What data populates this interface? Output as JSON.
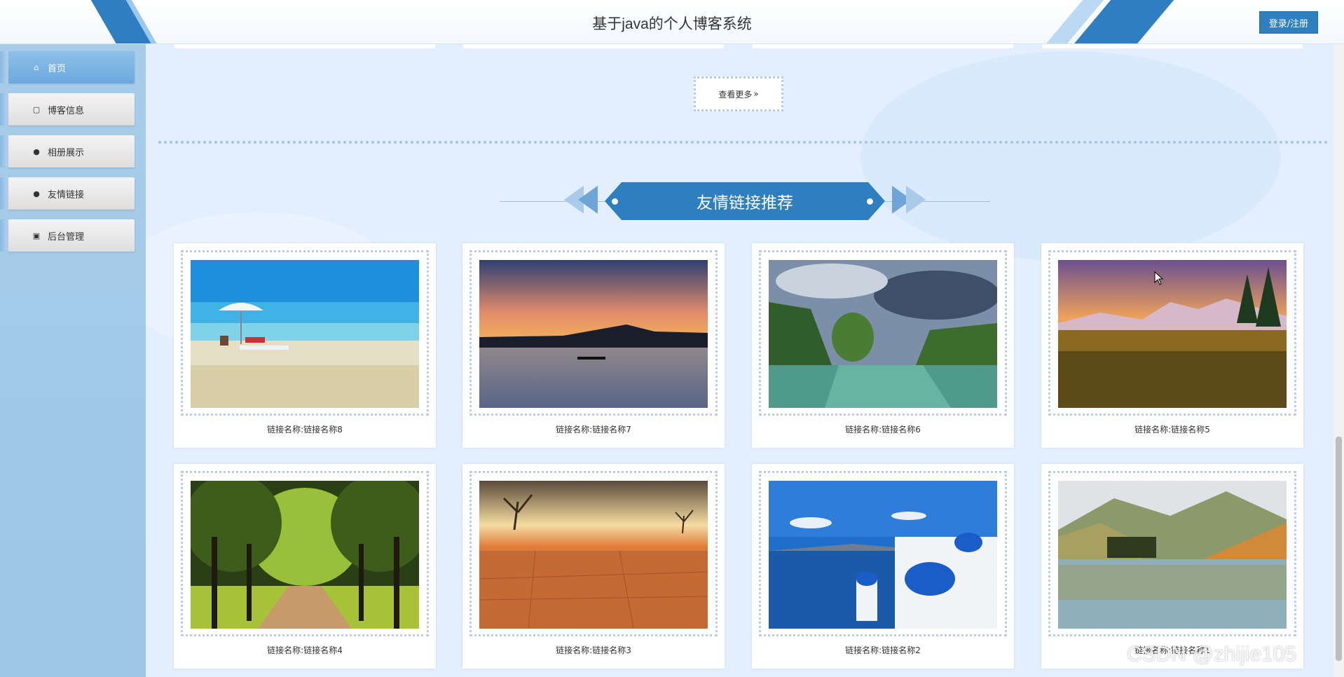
{
  "header": {
    "title": "基于java的个人博客系统",
    "login_label": "登录/注册"
  },
  "sidebar": {
    "items": [
      {
        "label": "首页",
        "icon": "home-icon",
        "active": true
      },
      {
        "label": "博客信息",
        "icon": "bag-icon",
        "active": false
      },
      {
        "label": "相册展示",
        "icon": "info-circle-icon",
        "active": false
      },
      {
        "label": "友情链接",
        "icon": "help-circle-icon",
        "active": false
      },
      {
        "label": "后台管理",
        "icon": "briefcase-icon",
        "active": false
      }
    ]
  },
  "main": {
    "more_label": "查看更多",
    "more_icon": "double-chevron-right-icon",
    "section_title": "友情链接推荐",
    "links": [
      {
        "caption": "链接名称:链接名称8",
        "scene": "beach"
      },
      {
        "caption": "链接名称:链接名称7",
        "scene": "sunset-lake"
      },
      {
        "caption": "链接名称:链接名称6",
        "scene": "river-forest"
      },
      {
        "caption": "链接名称:链接名称5",
        "scene": "flower-meadow"
      },
      {
        "caption": "链接名称:链接名称4",
        "scene": "tree-lane"
      },
      {
        "caption": "链接名称:链接名称3",
        "scene": "desert"
      },
      {
        "caption": "链接名称:链接名称2",
        "scene": "santorini"
      },
      {
        "caption": "链接名称:链接名称1",
        "scene": "mountain-lake"
      }
    ]
  },
  "watermark": "CSDN @zhijie105",
  "colors": {
    "accent": "#2e7fc0",
    "sidebar_bg": "#a8cdea",
    "page_bg": "#e3efff"
  }
}
